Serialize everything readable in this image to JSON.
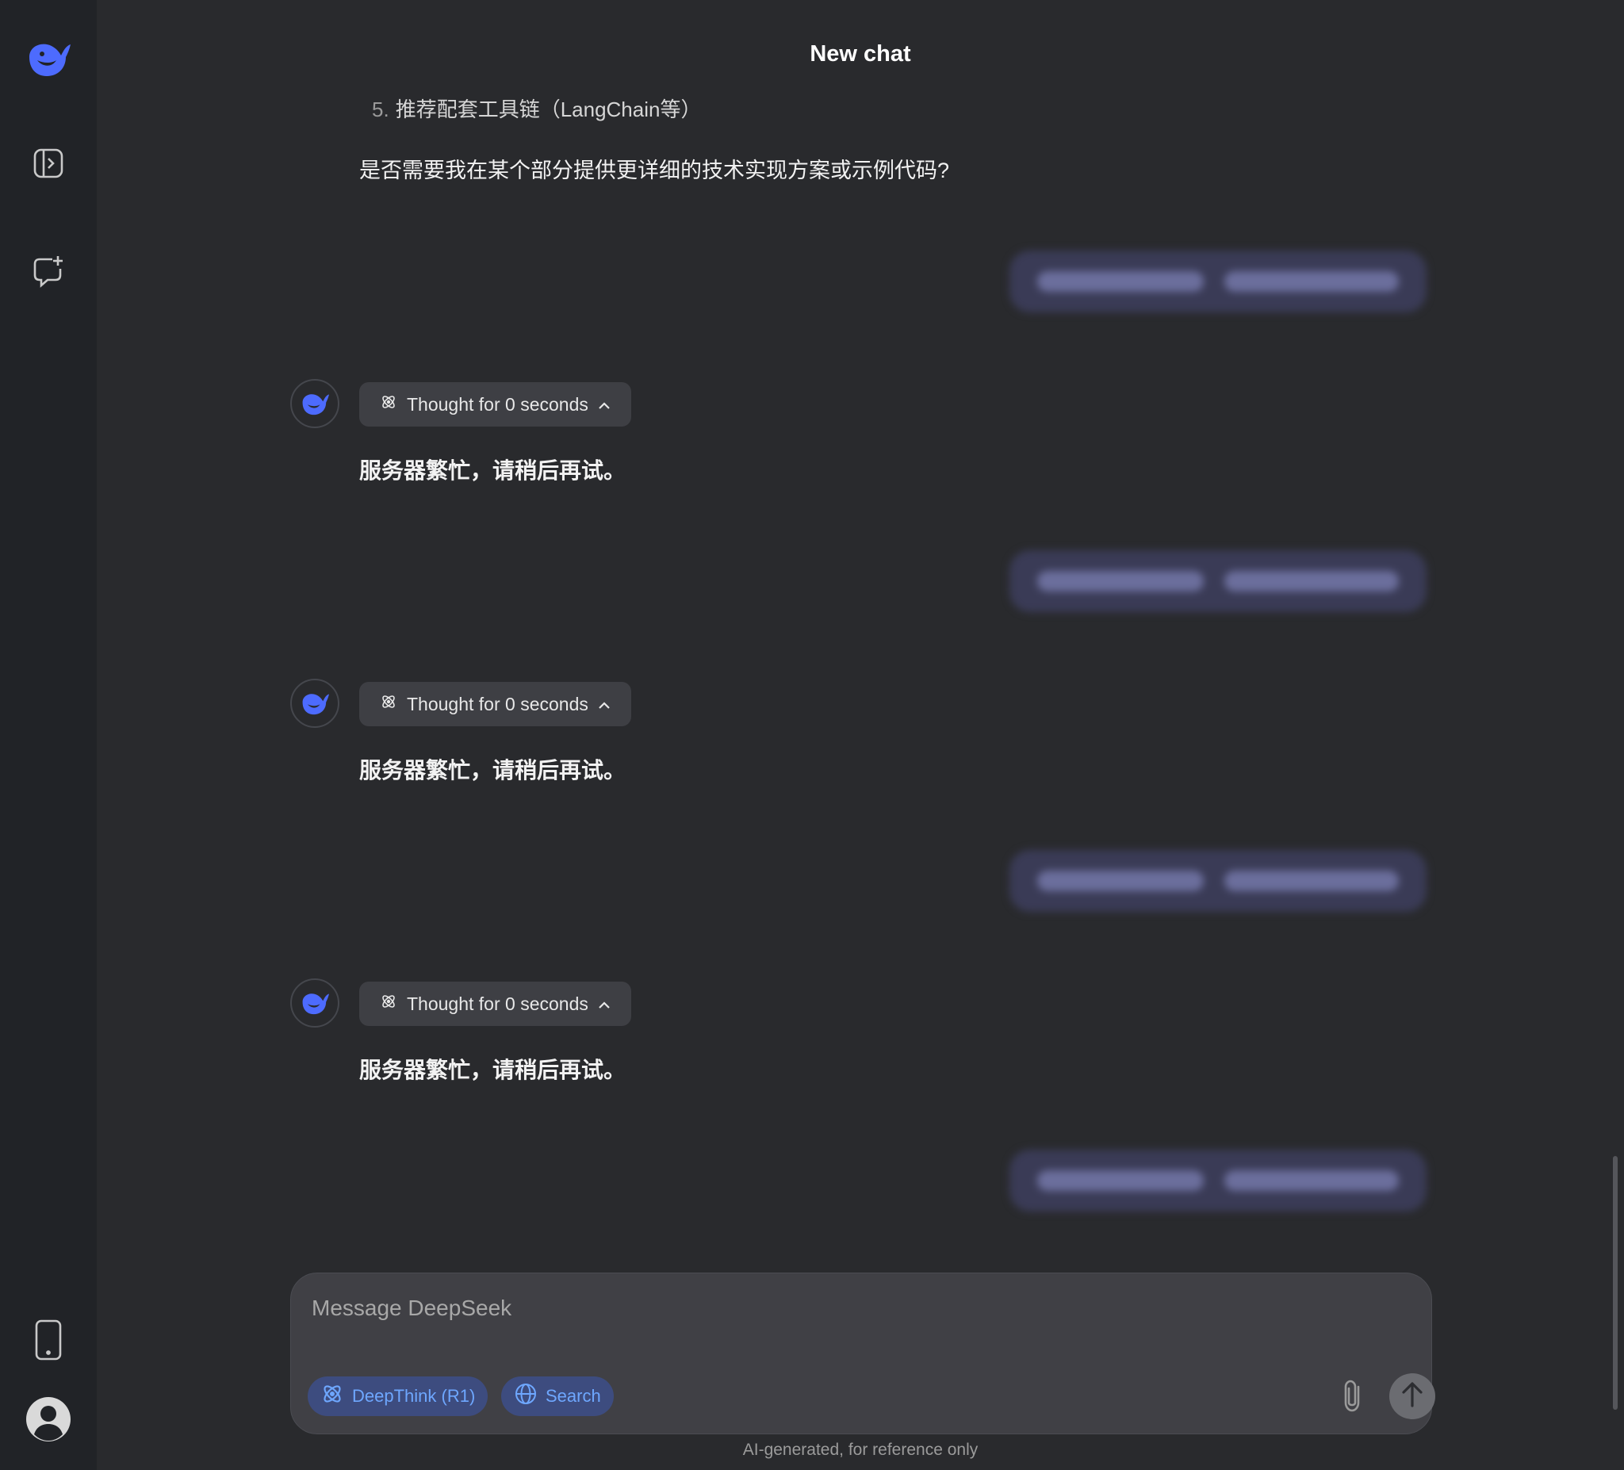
{
  "sidebar": {
    "logo_icon": "deepseek-whale-logo",
    "items": [
      {
        "name": "open-sidebar-icon"
      },
      {
        "name": "new-chat-icon"
      }
    ],
    "bottom": [
      {
        "name": "mobile-app-icon"
      },
      {
        "name": "profile-icon"
      }
    ]
  },
  "header": {
    "title": "New chat"
  },
  "conversation": {
    "list_item": {
      "number": "5.",
      "text": "推荐配套工具链（LangChain等）"
    },
    "question": "是否需要我在某个部分提供更详细的技术实现方案或示例代码?",
    "turns": [
      {
        "thought_label": "Thought for 0 seconds",
        "answer": "服务器繁忙，请稍后再试。"
      },
      {
        "thought_label": "Thought for 0 seconds",
        "answer": "服务器繁忙，请稍后再试。"
      },
      {
        "thought_label": "Thought for 0 seconds",
        "answer": "服务器繁忙，请稍后再试。"
      }
    ]
  },
  "composer": {
    "placeholder": "Message DeepSeek",
    "deepthink_label": "DeepThink (R1)",
    "search_label": "Search"
  },
  "footer": {
    "disclaimer": "AI-generated, for reference only"
  },
  "colors": {
    "accent": "#4d6bfe",
    "chip_text": "#6ea7ff",
    "background": "#292a2d",
    "sidebar": "#212327"
  }
}
